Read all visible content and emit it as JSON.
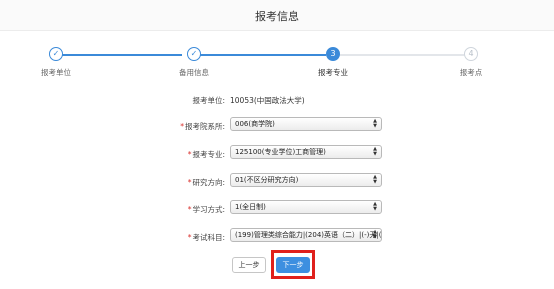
{
  "header": {
    "title": "报考信息"
  },
  "steps": [
    {
      "label": "报考单位",
      "status": "done",
      "icon": "check-icon",
      "glyph": "✓"
    },
    {
      "label": "备用信息",
      "status": "done",
      "icon": "check-icon",
      "glyph": "✓"
    },
    {
      "label": "报考专业",
      "status": "active",
      "number": "3"
    },
    {
      "label": "报考点",
      "status": "todo",
      "number": "4"
    }
  ],
  "form": {
    "unit": {
      "label": "报考单位:",
      "value": "10053(中国政法大学)"
    },
    "department": {
      "required": "*",
      "label": "报考院系所:",
      "value": "006(商学院)"
    },
    "major": {
      "required": "*",
      "label": "报考专业:",
      "value": "125100(专业学位)工商管理)"
    },
    "direction": {
      "required": "*",
      "label": "研究方向:",
      "value": "01(不区分研究方向)"
    },
    "study_mode": {
      "required": "*",
      "label": "学习方式:",
      "value": "1(全日制)"
    },
    "subjects": {
      "required": "*",
      "label": "考试科目:",
      "value": "(199)管理类综合能力|(204)英语（二）|(-)无|(-"
    }
  },
  "buttons": {
    "prev_label": "上一步",
    "next_label": "下一步"
  },
  "colors": {
    "accent": "#3b8ad9",
    "required": "#d9302c",
    "highlight": "#e0201c"
  }
}
